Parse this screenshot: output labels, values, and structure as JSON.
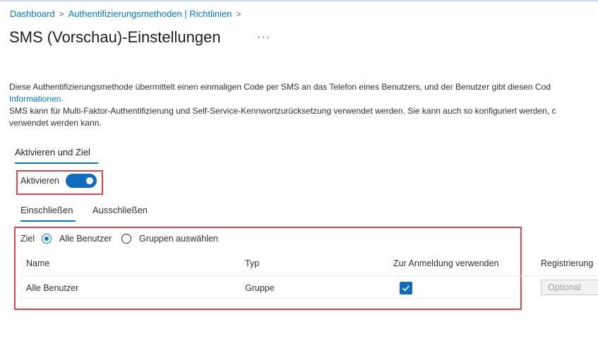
{
  "breadcrumb": {
    "items": [
      "Dashboard",
      "Authentifizierungsmethoden | Richtlinien"
    ],
    "separator": ">"
  },
  "page": {
    "title": "SMS (Vorschau)-Einstellungen",
    "more": "···"
  },
  "description": {
    "line1": "Diese Authentifizierungsmethode übermittelt einen einmaligen Code per SMS an das Telefon eines Benutzers, und der Benutzer gibt diesen Cod",
    "link": "Informationen.",
    "line3": "SMS kann für Multi-Faktor-Authentifizierung und Self-Service-Kennwortzurücksetzung verwendet werden. Sie kann auch so konfiguriert werden, c",
    "line4": "verwendet werden kann."
  },
  "section_tab": "Aktivieren und Ziel",
  "enable": {
    "label": "Aktivieren",
    "on": true
  },
  "subtabs": [
    "Einschließen",
    "Ausschließen"
  ],
  "target": {
    "label": "Ziel",
    "options": [
      "Alle Benutzer",
      "Gruppen auswählen"
    ],
    "selected": "Alle Benutzer"
  },
  "table": {
    "headers": [
      "Name",
      "Typ",
      "Zur Anmeldung verwenden",
      "Registrierung"
    ],
    "rows": [
      {
        "name": "Alle Benutzer",
        "type": "Gruppe",
        "sign_in": true,
        "registration": "Optional"
      }
    ]
  },
  "colors": {
    "accent": "#0078d4",
    "highlight_box": "#e0464f"
  }
}
